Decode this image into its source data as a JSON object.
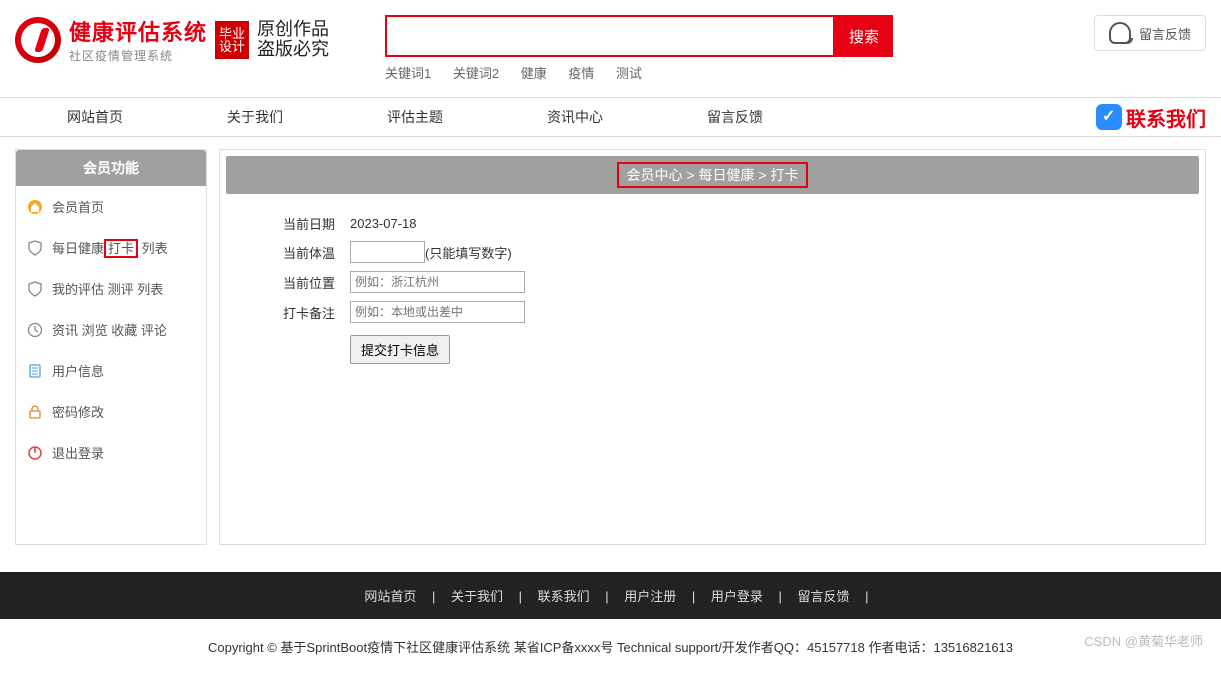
{
  "logo": {
    "title": "健康评估系统",
    "subtitle": "社区疫情管理系统",
    "badge_l1": "毕业",
    "badge_l2": "设计",
    "calli_l1": "原创作品",
    "calli_l2": "盗版必究"
  },
  "search": {
    "button": "搜索",
    "keywords": [
      "关键词1",
      "关键词2",
      "健康",
      "疫情",
      "测试"
    ]
  },
  "top_feedback": "留言反馈",
  "nav": [
    "网站首页",
    "关于我们",
    "评估主题",
    "资讯中心",
    "留言反馈"
  ],
  "contact_label": "联系我们",
  "sidebar": {
    "header": "会员功能",
    "items": [
      {
        "icon": "home-icon",
        "text": "会员首页"
      },
      {
        "icon": "shield-icon",
        "pre": "每日健康",
        "hl": "打卡",
        "post": " 列表"
      },
      {
        "icon": "shield-icon",
        "text": "我的评估 测评 列表"
      },
      {
        "icon": "clock-icon",
        "text": "资讯 浏览 收藏 评论"
      },
      {
        "icon": "user-icon",
        "text": "用户信息"
      },
      {
        "icon": "lock-icon",
        "text": "密码修改"
      },
      {
        "icon": "power-icon",
        "text": "退出登录"
      }
    ]
  },
  "breadcrumb": "会员中心 > 每日健康 > 打卡",
  "form": {
    "r1_label": "当前日期",
    "r1_value": "2023-07-18",
    "r2_label": "当前体温",
    "r2_hint": "(只能填写数字)",
    "r3_label": "当前位置",
    "r3_ph": "例如：浙江杭州",
    "r4_label": "打卡备注",
    "r4_ph": "例如：本地或出差中",
    "submit": "提交打卡信息"
  },
  "footer_links": [
    "网站首页",
    "关于我们",
    "联系我们",
    "用户注册",
    "用户登录",
    "留言反馈"
  ],
  "footer_text": "Copyright © 基于SprintBoot疫情下社区健康评估系统   某省ICP备xxxx号     Technical support/开发作者QQ：45157718     作者电话：13516821613",
  "watermark": "CSDN @黄菊华老师"
}
